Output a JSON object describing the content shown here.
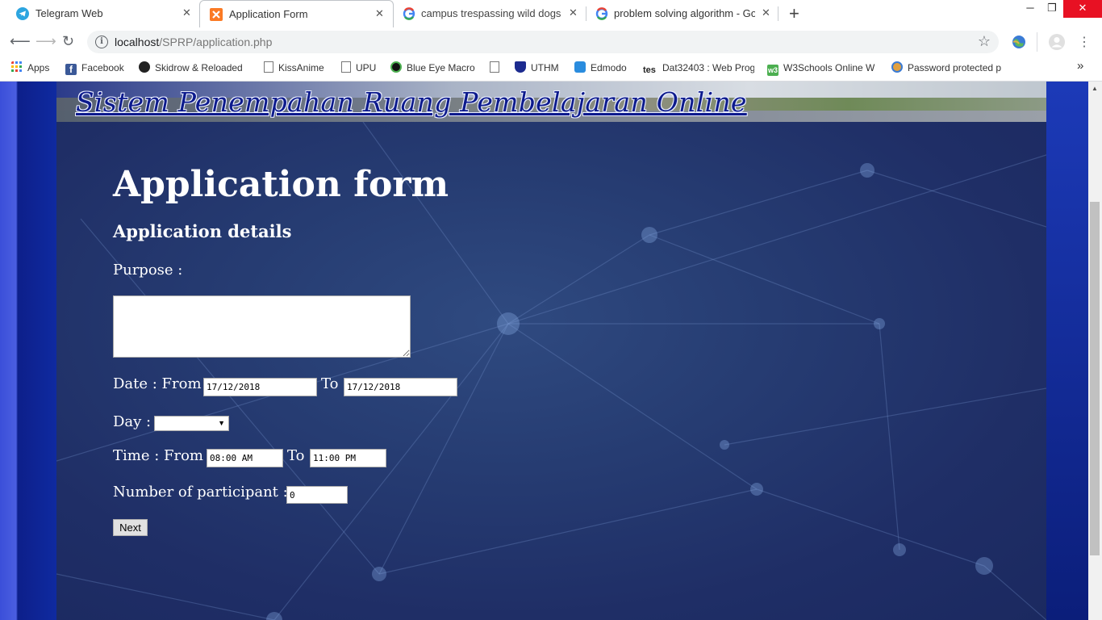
{
  "browser": {
    "tabs": [
      {
        "title": "Telegram Web",
        "icon": "telegram-icon"
      },
      {
        "title": "Application Form",
        "icon": "xampp-icon"
      },
      {
        "title": "campus trespassing wild dogs iss",
        "icon": "google-icon"
      },
      {
        "title": "problem solving algorithm - Goo",
        "icon": "google-icon"
      }
    ],
    "new_tab_label": "+",
    "url_host": "localhost",
    "url_path": "/SPRP/application.php",
    "bookmarks": [
      {
        "label": "Apps",
        "icon": "apps-grid-icon"
      },
      {
        "label": "Facebook",
        "icon": "facebook-icon"
      },
      {
        "label": "Skidrow & Reloaded",
        "icon": "skidrow-icon"
      },
      {
        "label": "KissAnime",
        "icon": "page-icon"
      },
      {
        "label": "UPU",
        "icon": "page-icon"
      },
      {
        "label": "Blue Eye Macro",
        "icon": "eye-icon"
      },
      {
        "label": "",
        "icon": "page-icon"
      },
      {
        "label": "UTHM",
        "icon": "shield-icon"
      },
      {
        "label": "Edmodo",
        "icon": "edmodo-icon"
      },
      {
        "label": "Dat32403 : Web Prog",
        "icon": "tes-icon"
      },
      {
        "label": "W3Schools Online W",
        "icon": "w3schools-icon"
      },
      {
        "label": "Password protected p",
        "icon": "lock-ribbon-icon"
      }
    ],
    "more_bookmarks_label": "»"
  },
  "page": {
    "site_title": "Sistem Penempahan Ruang Pembelajaran Online",
    "form_title": "Application form",
    "section_title": "Application details",
    "purpose_label": "Purpose :",
    "purpose_value": "",
    "date_from_label": "Date : From",
    "date_from_value": "17/12/2018",
    "date_to_label": "To",
    "date_to_value": "17/12/2018",
    "day_label": "Day :",
    "day_value": "",
    "time_from_label": "Time : From",
    "time_from_value": "08:00 AM",
    "time_to_label": "To",
    "time_to_value": "11:00 PM",
    "participants_label": "Number of participant :",
    "participants_value": "0",
    "next_label": "Next"
  },
  "colors": {
    "page_bg": "#1f2e66",
    "title_link": "#0c1a8c",
    "text": "#ffffff"
  }
}
